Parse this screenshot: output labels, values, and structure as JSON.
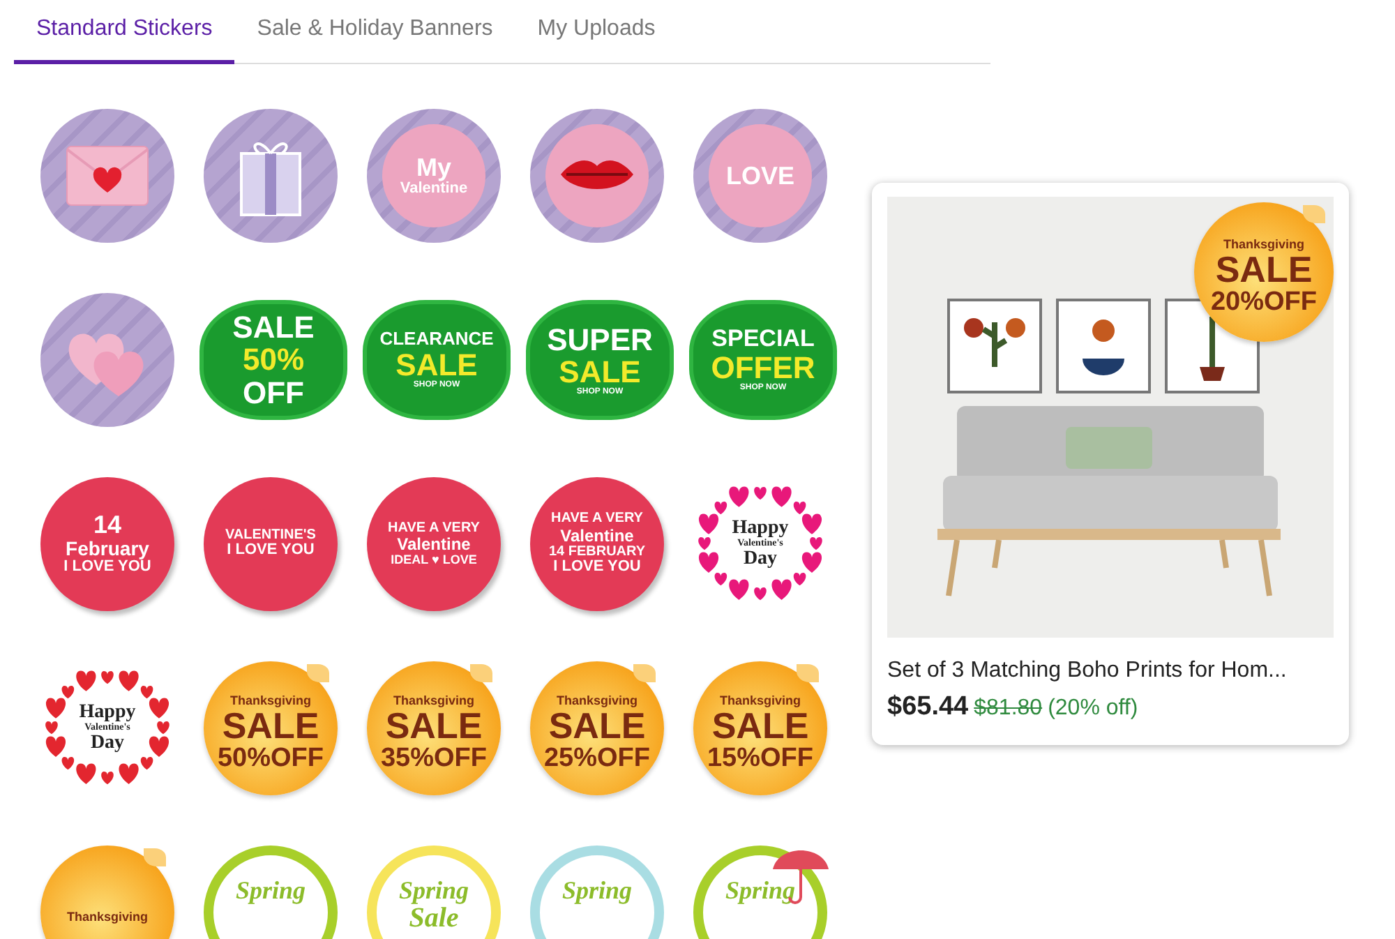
{
  "tabs": [
    {
      "label": "Standard Stickers",
      "selected": true
    },
    {
      "label": "Sale & Holiday Banners",
      "selected": false
    },
    {
      "label": "My Uploads",
      "selected": false
    }
  ],
  "stickers": [
    {
      "kind": "envelope"
    },
    {
      "kind": "gift"
    },
    {
      "kind": "lilac",
      "lines": [
        "My",
        "Valentine"
      ]
    },
    {
      "kind": "lips"
    },
    {
      "kind": "lilac",
      "lines": [
        "LOVE"
      ]
    },
    {
      "kind": "hearts"
    },
    {
      "kind": "cloud",
      "lines": [
        "SALE",
        "50%",
        "OFF"
      ]
    },
    {
      "kind": "cloud",
      "lines": [
        "CLEARANCE",
        "SALE",
        "SHOP NOW"
      ]
    },
    {
      "kind": "cloud",
      "lines": [
        "SUPER",
        "SALE",
        "SHOP NOW"
      ]
    },
    {
      "kind": "cloud",
      "lines": [
        "SPECIAL",
        "OFFER",
        "SHOP NOW"
      ]
    },
    {
      "kind": "redcircle",
      "lines": [
        "14",
        "February",
        "I LOVE YOU"
      ]
    },
    {
      "kind": "redcircle",
      "lines": [
        "VALENTINE'S",
        "I LOVE YOU"
      ]
    },
    {
      "kind": "redcircle",
      "lines": [
        "HAVE A VERY",
        "Valentine",
        "IDEAL ♥ LOVE"
      ]
    },
    {
      "kind": "redcircle",
      "lines": [
        "HAVE A VERY",
        "Valentine",
        "14 FEBRUARY",
        "I LOVE YOU"
      ]
    },
    {
      "kind": "wreath",
      "color": "#e8187a",
      "lines": [
        "Happy",
        "Valentine's",
        "Day"
      ]
    },
    {
      "kind": "wreath",
      "color": "#e3262f",
      "lines": [
        "Happy",
        "Valentine's",
        "Day"
      ]
    },
    {
      "kind": "peel",
      "lines": [
        "Thanksgiving",
        "SALE",
        "50%OFF"
      ]
    },
    {
      "kind": "peel",
      "lines": [
        "Thanksgiving",
        "SALE",
        "35%OFF"
      ]
    },
    {
      "kind": "peel",
      "lines": [
        "Thanksgiving",
        "SALE",
        "25%OFF"
      ]
    },
    {
      "kind": "peel",
      "lines": [
        "Thanksgiving",
        "SALE",
        "15%OFF"
      ]
    },
    {
      "kind": "peel",
      "lines": [
        "Thanksgiving"
      ]
    },
    {
      "kind": "spring",
      "color": "#a8cf2a",
      "lines": [
        "Spring"
      ]
    },
    {
      "kind": "spring",
      "color": "#f6e45a",
      "lines": [
        "Spring",
        "Sale"
      ]
    },
    {
      "kind": "spring",
      "color": "#a9dde3",
      "lines": [
        "Spring"
      ]
    },
    {
      "kind": "umbrella",
      "color": "#a8cf2a",
      "lines": [
        "Spring"
      ]
    }
  ],
  "product": {
    "badge": [
      "Thanksgiving",
      "SALE",
      "20%OFF"
    ],
    "title": "Set of 3 Matching Boho Prints for Hom...",
    "price": "$65.44",
    "old_price": "$81.80",
    "discount": "(20% off)"
  }
}
